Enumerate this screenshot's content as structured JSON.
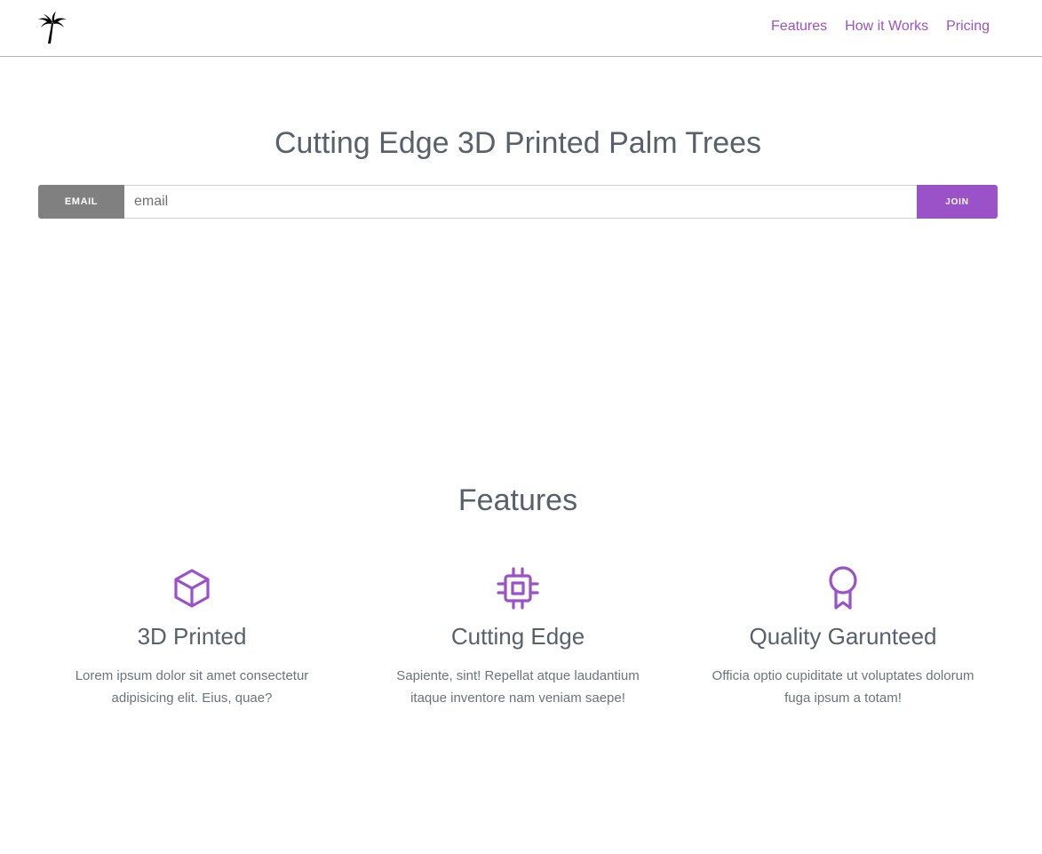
{
  "header": {
    "logo_icon": "palm-tree-icon",
    "nav": [
      {
        "label": "Features"
      },
      {
        "label": "How it Works"
      },
      {
        "label": "Pricing"
      }
    ]
  },
  "hero": {
    "title": "Cutting Edge 3D Printed Palm Trees",
    "form": {
      "label": "EMAIL",
      "placeholder": "email",
      "value": "",
      "button": "JOIN"
    }
  },
  "features": {
    "title": "Features",
    "items": [
      {
        "icon": "cube-icon",
        "title": "3D Printed",
        "text": "Lorem ipsum dolor sit amet consectetur adipisicing elit. Eius, quae?"
      },
      {
        "icon": "chip-icon",
        "title": "Cutting Edge",
        "text": "Sapiente, sint! Repellat atque laudantium itaque inventore nam veniam saepe!"
      },
      {
        "icon": "award-ribbon-icon",
        "title": "Quality Garunteed",
        "text": "Officia optio cupiditate ut voluptates dolorum fuga ipsum a totam!"
      }
    ]
  },
  "colors": {
    "accent": "#9b51c7",
    "heading": "#58606a",
    "label_bg": "#808080"
  }
}
